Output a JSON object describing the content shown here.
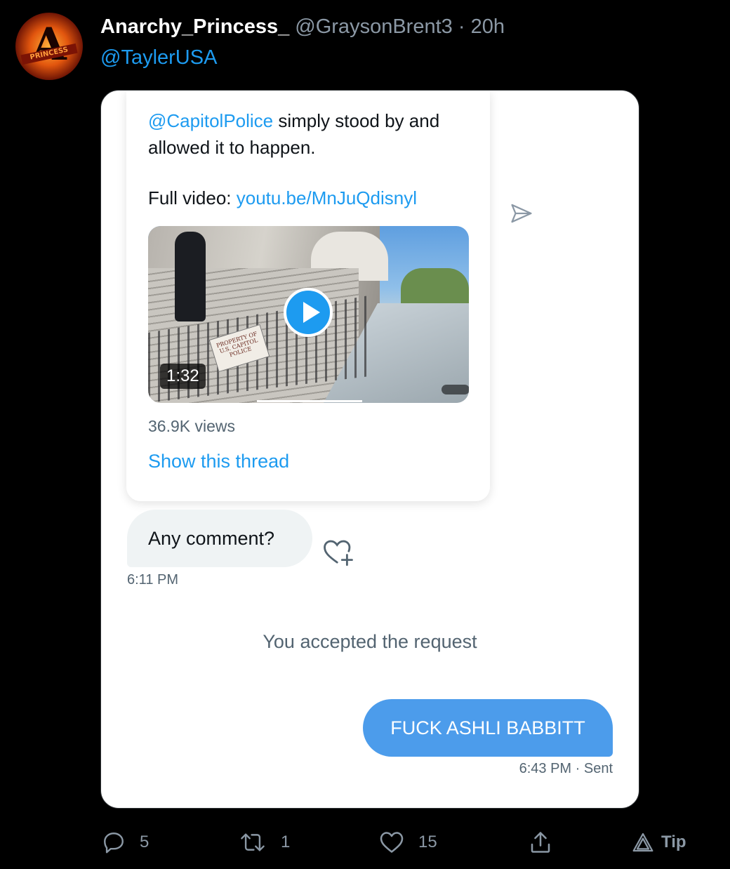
{
  "tweet": {
    "display_name": "Anarchy_Princess_",
    "handle": "@GraysonBrent3",
    "separator": "·",
    "time": "20h",
    "reply_to": "@TaylerUSA",
    "avatar_banner": "PRINCESS"
  },
  "screenshot": {
    "card": {
      "mention": "@CapitolPolice",
      "text": " simply stood by and allowed it to happen.",
      "full_video_label": "Full video: ",
      "full_video_link": "youtu.be/MnJuQdisnyl",
      "video_duration": "1:32",
      "sign_text": "PROPERTY OF U.S. CAPITOL POLICE",
      "views": "36.9K views",
      "show_thread": "Show this thread"
    },
    "received_message": {
      "text": "Any comment?",
      "time": "6:11 PM"
    },
    "status": "You accepted the request",
    "sent_message": {
      "text": "FUCK ASHLI BABBITT",
      "time": "6:43 PM",
      "status": "· Sent"
    }
  },
  "actions": {
    "reply_count": "5",
    "retweet_count": "1",
    "like_count": "15",
    "tip_label": "Tip"
  },
  "icons": {
    "accent": "#1d9bf0",
    "sent_bubble": "#4c9ceb",
    "action_gray": "#8b98a5"
  }
}
